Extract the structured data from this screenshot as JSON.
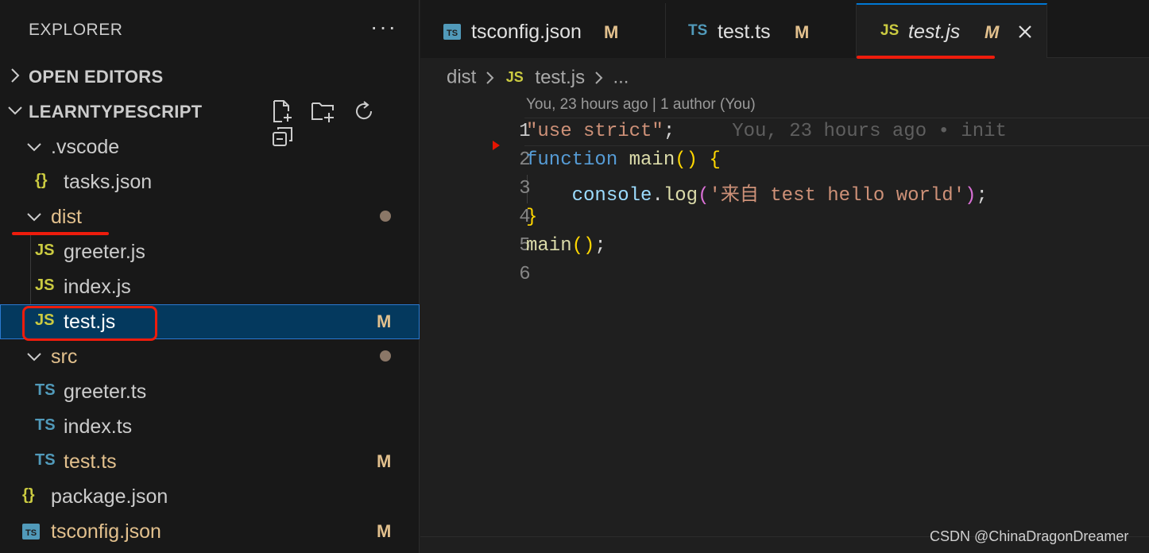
{
  "sidebar": {
    "title": "EXPLORER",
    "more_label": "···",
    "open_editors_label": "OPEN EDITORS",
    "project_label": "LEARNTYPESCRIPT",
    "tree": {
      "vscode_folder": ".vscode",
      "tasks_json": "tasks.json",
      "dist_folder": "dist",
      "dist_greeter": "greeter.js",
      "dist_index": "index.js",
      "dist_test": "test.js",
      "dist_test_badge": "M",
      "src_folder": "src",
      "src_greeter": "greeter.ts",
      "src_index": "index.ts",
      "src_test": "test.ts",
      "src_test_badge": "M",
      "package_json": "package.json",
      "tsconfig_json": "tsconfig.json",
      "tsconfig_badge": "M"
    },
    "icons": {
      "js": "JS",
      "ts": "TS",
      "json": "{}",
      "tsconfig": "TS"
    }
  },
  "tabs": [
    {
      "icon": "TS",
      "label": "tsconfig.json",
      "badge": "M"
    },
    {
      "icon": "TS",
      "label": "test.ts",
      "badge": "M"
    },
    {
      "icon": "JS",
      "label": "test.js",
      "badge": "M"
    }
  ],
  "breadcrumb": {
    "folder": "dist",
    "file_icon": "JS",
    "file": "test.js",
    "ellipsis": "..."
  },
  "blame": {
    "header": "You, 23 hours ago | 1 author (You)",
    "inline": "You, 23 hours ago • init"
  },
  "code": {
    "line_numbers": [
      "1",
      "2",
      "3",
      "4",
      "5",
      "6"
    ],
    "l1_str": "\"use strict\"",
    "l1_semi": ";",
    "l2_kw": "function",
    "l2_fn": "main",
    "l2_paren": "()",
    "l2_brace": "{",
    "l3_obj": "console",
    "l3_dot": ".",
    "l3_fn": "log",
    "l3_open": "(",
    "l3_str": "'来自 test hello world'",
    "l3_close": ")",
    "l3_semi": ";",
    "l4_brace": "}",
    "l5_fn": "main",
    "l5_paren": "()",
    "l5_semi": ";"
  },
  "watermark": "CSDN @ChinaDragonDreamer",
  "colors": {
    "modified": "#e2c08d",
    "selection": "#04395e",
    "annotation_red": "#ee1c0c"
  }
}
